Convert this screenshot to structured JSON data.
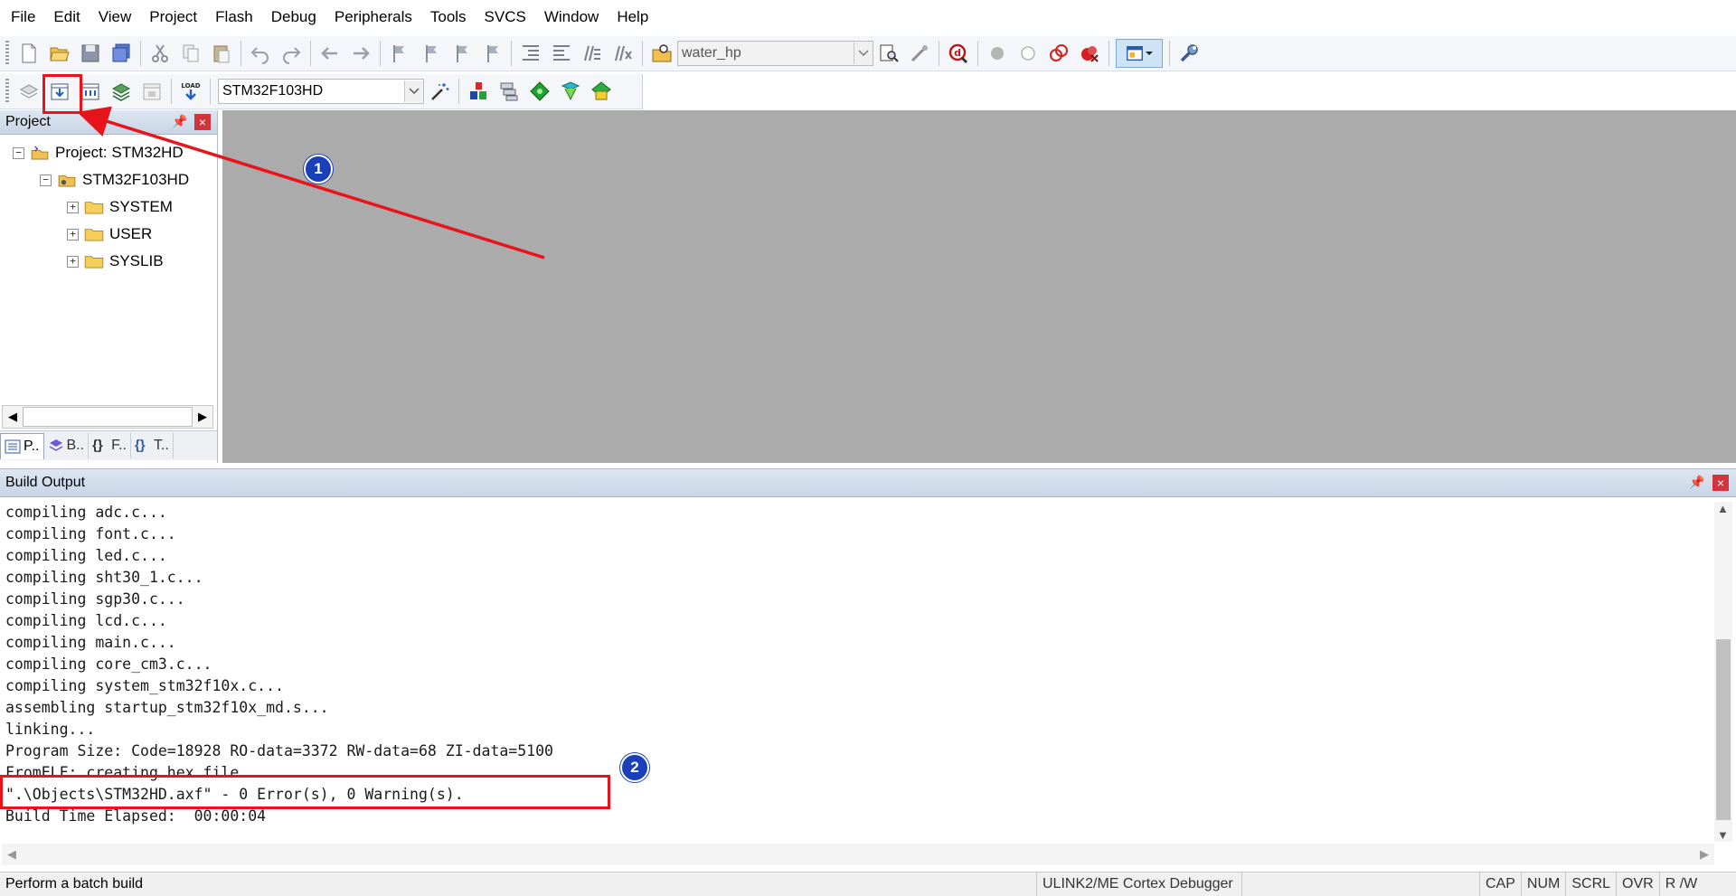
{
  "menu": [
    "File",
    "Edit",
    "View",
    "Project",
    "Flash",
    "Debug",
    "Peripherals",
    "Tools",
    "SVCS",
    "Window",
    "Help"
  ],
  "toolbar1": {
    "find_combo_value": "water_hp"
  },
  "toolbar2": {
    "target_combo_value": "STM32F103HD"
  },
  "project_panel": {
    "title": "Project",
    "tree": {
      "root": "Project: STM32HD",
      "target": "STM32F103HD",
      "groups": [
        "SYSTEM",
        "USER",
        "SYSLIB"
      ]
    },
    "tabs": [
      "P..",
      "B..",
      "F..",
      "T.."
    ]
  },
  "output_panel": {
    "title": "Build Output",
    "lines": [
      "compiling adc.c...",
      "compiling font.c...",
      "compiling led.c...",
      "compiling sht30_1.c...",
      "compiling sgp30.c...",
      "compiling lcd.c...",
      "compiling main.c...",
      "compiling core_cm3.c...",
      "compiling system_stm32f10x.c...",
      "assembling startup_stm32f10x_md.s...",
      "linking...",
      "Program Size: Code=18928 RO-data=3372 RW-data=68 ZI-data=5100",
      "FromELF: creating hex file...",
      "\".\\Objects\\STM32HD.axf\" - 0 Error(s), 0 Warning(s).",
      "Build Time Elapsed:  00:00:04"
    ]
  },
  "statusbar": {
    "message": "Perform a batch build",
    "debugger": "ULINK2/ME Cortex Debugger",
    "indicators": [
      "CAP",
      "NUM",
      "SCRL",
      "OVR",
      "R /W"
    ]
  },
  "annotations": {
    "step1": "1",
    "step2": "2",
    "color": "#e8141c",
    "badge_color": "#1a3fb8"
  }
}
